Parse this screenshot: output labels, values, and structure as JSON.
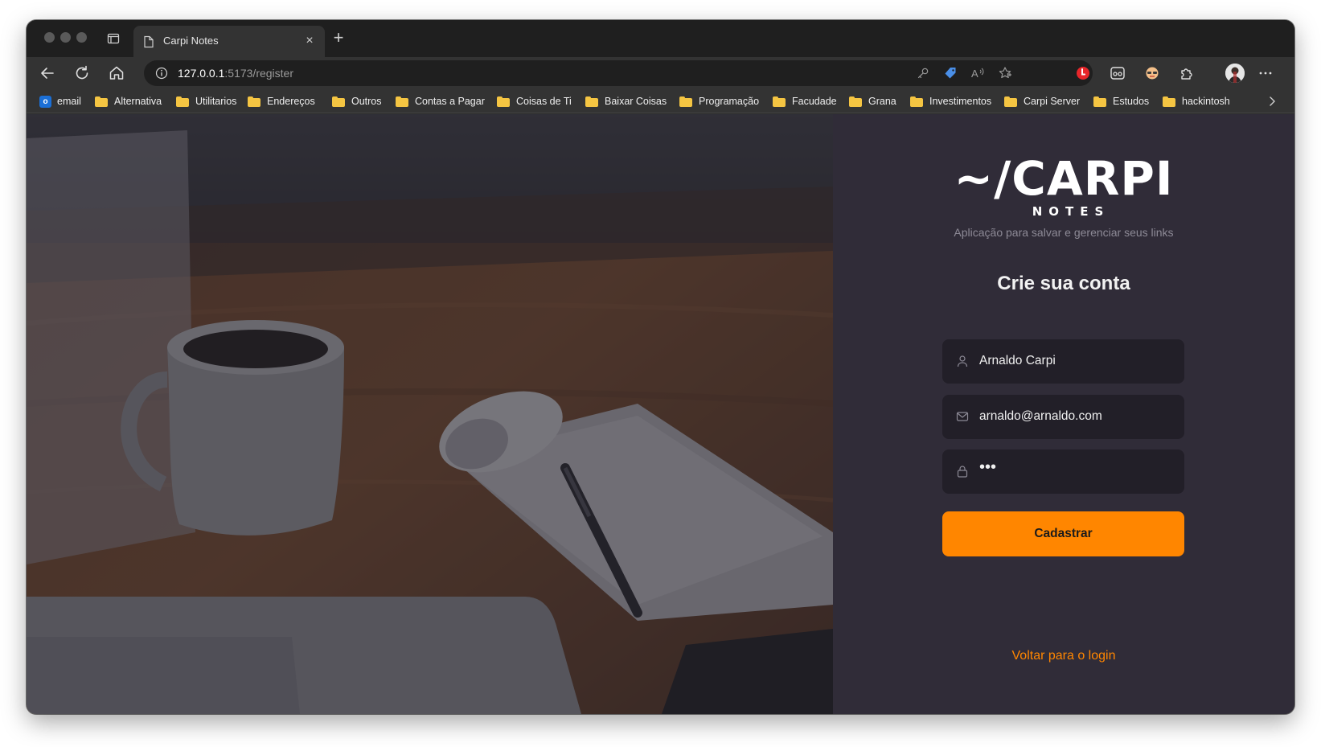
{
  "browser": {
    "tab_title": "Carpi Notes",
    "tab_close": "×",
    "new_tab": "+",
    "url_host": "127.0.0.1",
    "url_rest": ":5173/register"
  },
  "bookmarks": {
    "items": [
      {
        "label": "email",
        "icon": "outlook-icon"
      },
      {
        "label": "Alternativa",
        "icon": "folder-icon"
      },
      {
        "label": "Utilitarios",
        "icon": "folder-icon"
      },
      {
        "label": "Endereços",
        "icon": "folder-icon"
      },
      {
        "label": "Outros",
        "icon": "folder-icon"
      },
      {
        "label": "Contas a Pagar",
        "icon": "folder-icon"
      },
      {
        "label": "Coisas de Ti",
        "icon": "folder-icon"
      },
      {
        "label": "Baixar Coisas",
        "icon": "folder-icon"
      },
      {
        "label": "Programação",
        "icon": "folder-icon"
      },
      {
        "label": "Facudade",
        "icon": "folder-icon"
      },
      {
        "label": "Grana",
        "icon": "folder-icon"
      },
      {
        "label": "Investimentos",
        "icon": "folder-icon"
      },
      {
        "label": "Carpi Server",
        "icon": "folder-icon"
      },
      {
        "label": "Estudos",
        "icon": "folder-icon"
      },
      {
        "label": "hackintosh",
        "icon": "folder-icon"
      }
    ]
  },
  "app": {
    "logo_text": "~/CARPI",
    "logo_sub": "NOTES",
    "tagline": "Aplicação para salvar e gerenciar seus links",
    "heading": "Crie sua conta",
    "fields": {
      "name": {
        "value": "Arnaldo Carpi",
        "icon": "user-icon"
      },
      "email": {
        "value": "arnaldo@arnaldo.com",
        "icon": "mail-icon"
      },
      "password": {
        "value": "•••",
        "icon": "lock-icon"
      }
    },
    "submit_label": "Cadastrar",
    "back_link": "Voltar para o login"
  },
  "colors": {
    "accent": "#ff8600",
    "panel_bg": "#302c38",
    "field_bg": "#221f28"
  }
}
